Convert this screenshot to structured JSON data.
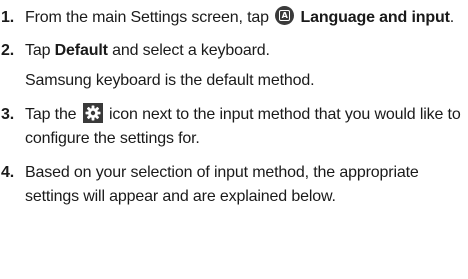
{
  "intro_line_cut": "Settings screen tap",
  "steps": [
    {
      "number": "1",
      "pre": "From the main Settings screen, tap ",
      "icon": "language-input-icon",
      "bold": "Language and input",
      "post": "."
    },
    {
      "number": "2",
      "pre": "Tap ",
      "bold": "Default",
      "post": " and select a keyboard.",
      "note": "Samsung keyboard is the default method."
    },
    {
      "number": "3",
      "pre": "Tap the ",
      "icon": "settings-gear-icon",
      "post": " icon next to the input method that you would like to configure the settings for."
    },
    {
      "number": "4",
      "text": "Based on your selection of input method, the appropriate settings will appear and are explained below."
    }
  ]
}
